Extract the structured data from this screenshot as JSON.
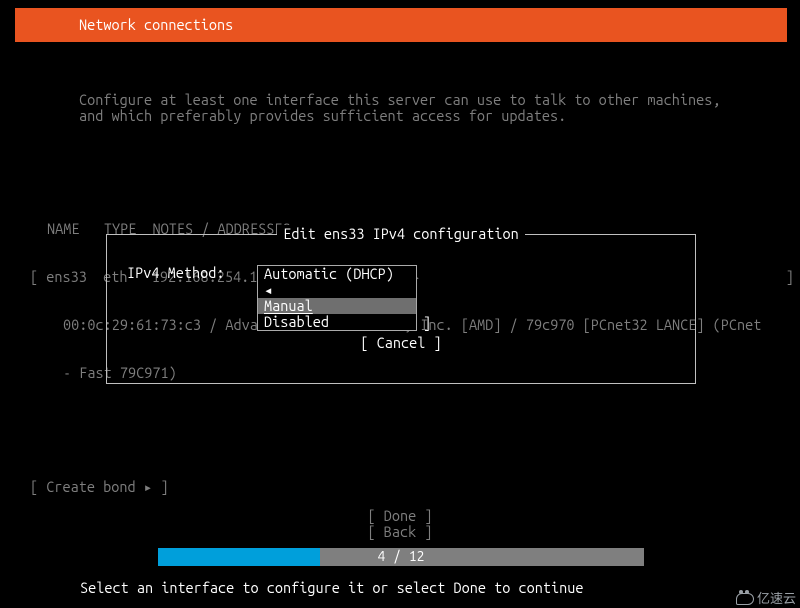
{
  "header": {
    "title": "Network connections"
  },
  "intro": {
    "line1": "Configure at least one interface this server can use to talk to other machines,",
    "line2": "and which preferably provides sufficient access for updates."
  },
  "table": {
    "header": "NAME   TYPE  NOTES / ADDRESSES",
    "iface_row": "[ ens33  eth   192.168.254.128/24 (from dhcp)  ▸                                             ]",
    "notes_line1": "00:0c:29:61:73:c3 / Advanced Micro Devices, Inc. [AMD] / 79c970 [PCnet32 LANCE] (PCnet",
    "notes_line2": "- Fast 79C971)"
  },
  "create_bond": "[ Create bond ▸ ]",
  "dialog": {
    "title": "Edit ens33 IPv4 configuration",
    "method_label": "IPv4 Method:",
    "options": {
      "auto": "Automatic (DHCP) ◂",
      "manual": "Manual",
      "disabled": "Disabled"
    },
    "close_bracket": "]",
    "cancel": "[ Cancel    ]"
  },
  "buttons": {
    "done": "[ Done       ]",
    "back": "[ Back       ]"
  },
  "progress": {
    "current": 4,
    "total": 12,
    "label": "4 / 12",
    "percent": 33.3
  },
  "hint": "Select an interface to configure it or select Done to continue",
  "watermark": "亿速云"
}
